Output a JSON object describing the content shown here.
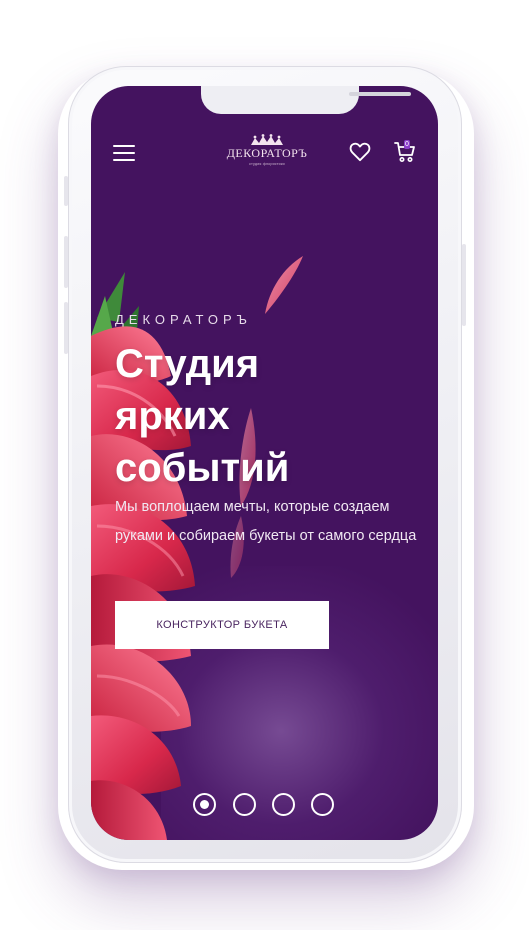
{
  "header": {
    "menu_icon": "hamburger-menu-icon",
    "logo_name": "ДЕКОРАТОРЪ",
    "logo_tagline": "студия флористики",
    "favorites_icon": "heart-icon",
    "cart_icon": "cart-icon",
    "cart_count": "0"
  },
  "hero": {
    "brand": "ДЕКОРАТОРЪ",
    "title_lines": [
      "Студия",
      "ярких",
      "событий"
    ],
    "description": "Мы воплощаем мечты, которые создаем руками и собираем букеты от самого сердца",
    "cta_label": "КОНСТРУКТОР БУКЕТА"
  },
  "carousel": {
    "slides": 4,
    "active_index": 0
  },
  "colors": {
    "background": "#44135f",
    "accent_glow": "#a078be",
    "button_text": "#4a2560",
    "flower": "#e8405f"
  }
}
